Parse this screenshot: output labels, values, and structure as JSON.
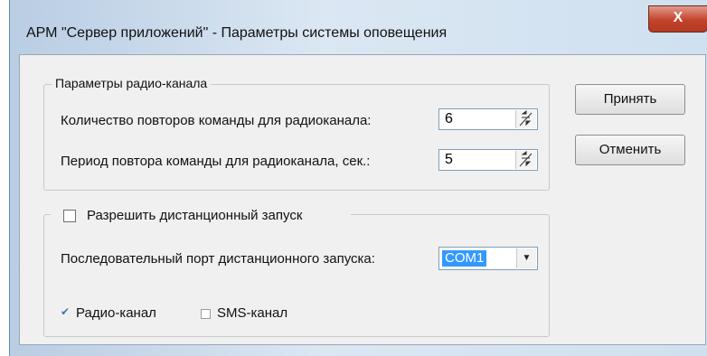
{
  "window": {
    "title": "АРМ \"Сервер приложений\" - Параметры системы оповещения",
    "close_glyph": "X"
  },
  "radio_group": {
    "legend": "Параметры радио-канала",
    "repeat_count_label": "Количество повторов команды для радиоканала:",
    "repeat_count_value": "6",
    "repeat_period_label": "Период повтора команды для радиоканала, сек.:",
    "repeat_period_value": "5"
  },
  "remote_group": {
    "enable_label": "Разрешить дистанционный запуск",
    "enable_checked": false,
    "port_label": "Последовательный порт дистанционного запуска:",
    "port_value": "COM1",
    "radio_channel_label": "Радио-канал",
    "radio_channel_checked": true,
    "sms_channel_label": "SMS-канал",
    "sms_channel_checked": false
  },
  "buttons": {
    "accept": "Принять",
    "cancel": "Отменить"
  },
  "icons": [
    "close-icon",
    "spin-arrows-icon",
    "dropdown-arrow-icon",
    "checkmark-icon"
  ]
}
